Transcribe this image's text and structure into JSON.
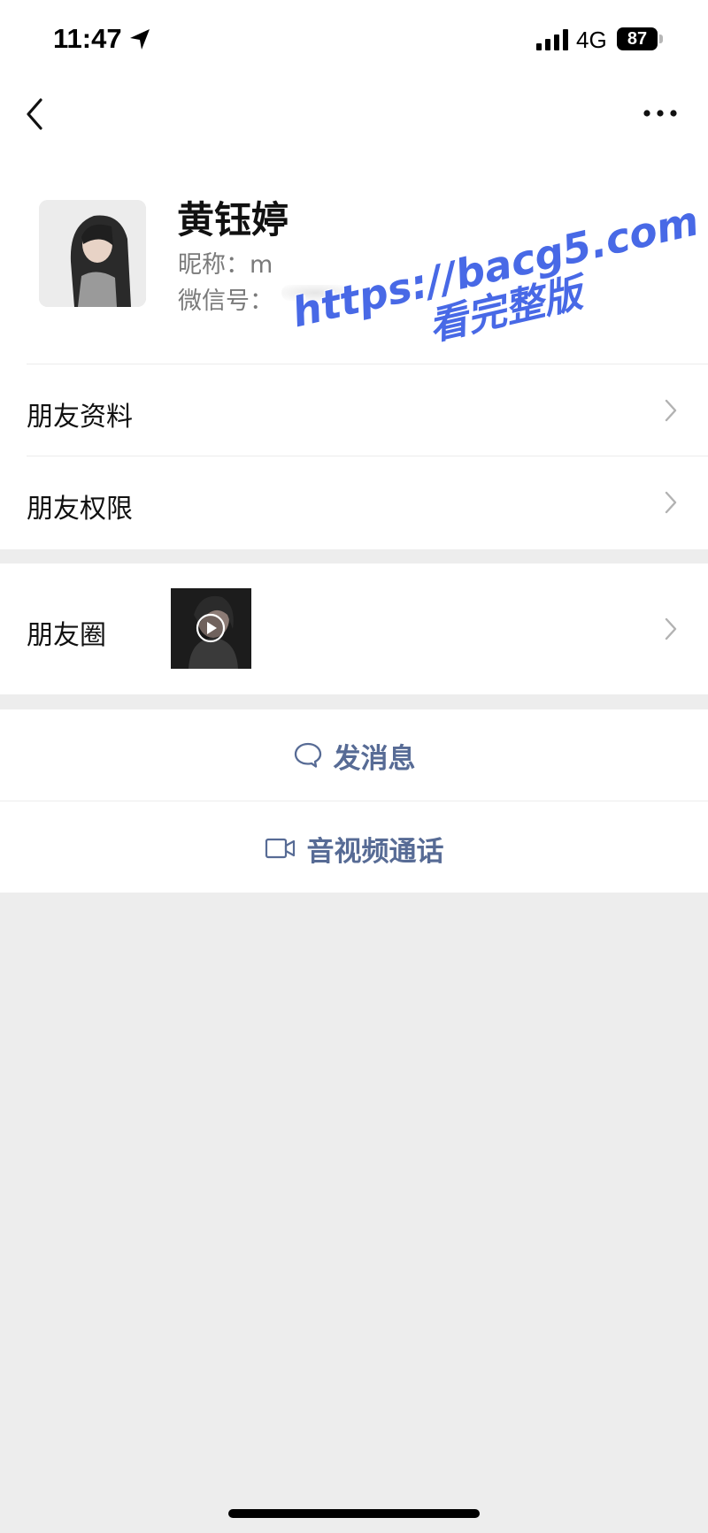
{
  "status_bar": {
    "time": "11:47",
    "network": "4G",
    "battery": "87"
  },
  "profile": {
    "name": "黄钰婷",
    "nickname": "昵称：m",
    "wechat_id_label": "微信号："
  },
  "menu": {
    "friend_info": "朋友资料",
    "friend_permissions": "朋友权限",
    "moments": "朋友圈"
  },
  "actions": {
    "message": "发消息",
    "video_call": "音视频通话"
  },
  "watermark": {
    "url": "https://bacg5.com",
    "subtitle": "看完整版"
  },
  "icons": {
    "status": [
      "location-arrow-icon",
      "signal-icon"
    ],
    "nav": [
      "back-icon",
      "more-icon"
    ],
    "rows": [
      "chevron-right-icon",
      "video-play-icon"
    ],
    "actions": [
      "chat-bubble-icon",
      "video-camera-icon"
    ]
  },
  "colors": {
    "link_blue": "#576b95",
    "watermark_blue": "#4869e6",
    "background": "#ededed"
  }
}
